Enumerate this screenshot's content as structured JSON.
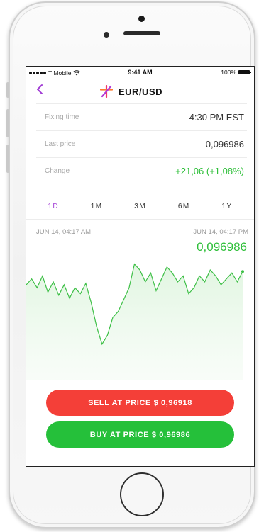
{
  "status_bar": {
    "carrier": "T Mobile",
    "time": "9:41 AM",
    "battery": "100%"
  },
  "nav": {
    "back_icon": "chevron-left-icon",
    "logo_icon": "star-logo-icon",
    "title": "EUR/USD"
  },
  "info": {
    "rows": [
      {
        "label": "Fixing time",
        "value": "4:30 PM EST"
      },
      {
        "label": "Last price",
        "value": "0,096986"
      },
      {
        "label": "Change",
        "value": "+21,06 (+1,08%)"
      }
    ]
  },
  "period_tabs": {
    "items": [
      "1D",
      "1M",
      "3M",
      "6M",
      "1Y"
    ],
    "active": "1D"
  },
  "chart": {
    "start_label": "JUN 14, 04:17 AM",
    "end_label": "JUN 14, 04:17 PM",
    "current_price": "0,096986"
  },
  "chart_data": {
    "type": "area",
    "title": "",
    "xlabel": "",
    "ylabel": "",
    "x_range": [
      "JUN 14, 04:17 AM",
      "JUN 14, 04:17 PM"
    ],
    "values": [
      0.0964,
      0.0966,
      0.0963,
      0.0967,
      0.09615,
      0.0965,
      0.09605,
      0.0964,
      0.09595,
      0.0963,
      0.0961,
      0.09645,
      0.0958,
      0.095,
      0.0944,
      0.0947,
      0.0953,
      0.0955,
      0.0959,
      0.0963,
      0.0971,
      0.0969,
      0.0965,
      0.0968,
      0.0962,
      0.0966,
      0.097,
      0.0968,
      0.0965,
      0.0967,
      0.0961,
      0.0963,
      0.0967,
      0.0965,
      0.0969,
      0.0967,
      0.0964,
      0.0966,
      0.0968,
      0.0965,
      0.09685
    ],
    "ylim": [
      0.0932,
      0.0975
    ],
    "grid": false,
    "colors": {
      "line": "#3cbf45",
      "fill": "#e6f7e6"
    }
  },
  "actions": {
    "sell_label": "SELL AT PRICE $ 0,96918",
    "buy_label": "BUY AT PRICE $ 0,96986"
  },
  "colors": {
    "accent": "#a13cd4",
    "positive": "#2fbf3a",
    "sell": "#f43f38",
    "buy": "#25c03a"
  }
}
